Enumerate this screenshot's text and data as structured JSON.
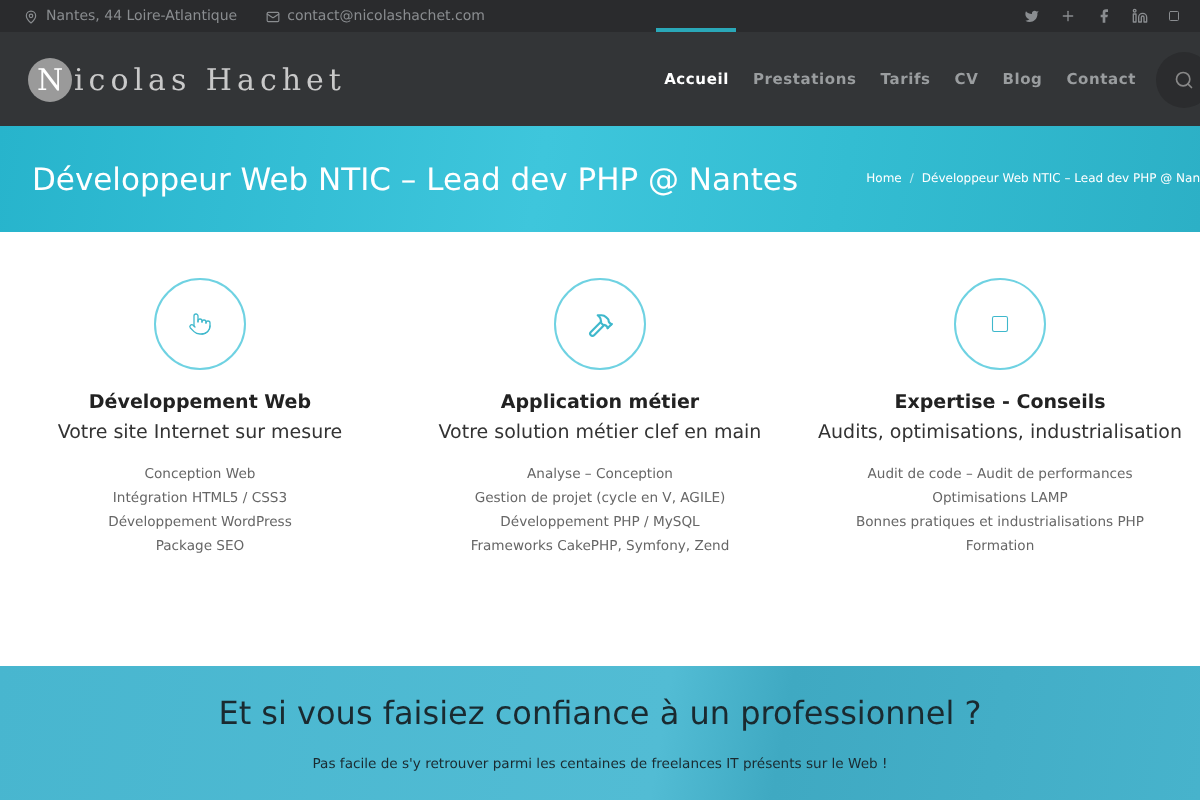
{
  "topbar": {
    "location": "Nantes, 44 Loire-Atlantique",
    "email": "contact@nicolashachet.com",
    "social": [
      {
        "kind": "twitter"
      },
      {
        "kind": "googleplus"
      },
      {
        "kind": "facebook"
      },
      {
        "kind": "linkedin"
      },
      {
        "kind": "other"
      }
    ]
  },
  "header": {
    "logo": {
      "initial": "N",
      "rest": "icolas Hachet"
    },
    "nav": [
      {
        "label": "Accueil",
        "selected": true
      },
      {
        "label": "Prestations",
        "selected": false
      },
      {
        "label": "Tarifs",
        "selected": false
      },
      {
        "label": "CV",
        "selected": false
      },
      {
        "label": "Blog",
        "selected": false
      },
      {
        "label": "Contact",
        "selected": false
      }
    ]
  },
  "banner": {
    "title": "Développeur Web NTIC – Lead dev PHP @ Nantes",
    "breadcrumb": [
      "Home",
      "Développeur Web NTIC – Lead dev PHP @ Nan"
    ],
    "breadcrumb_separator": "/"
  },
  "services": [
    {
      "kind": "pointer",
      "title": "Développement Web",
      "subtitle": "Votre site Internet sur mesure",
      "items": [
        "Conception Web",
        "Intégration HTML5 / CSS3",
        "Développement WordPress",
        "Package SEO"
      ]
    },
    {
      "kind": "tools",
      "title": "Application métier",
      "subtitle": "Votre solution métier clef en main",
      "items": [
        "Analyse – Conception",
        "Gestion de projet (cycle en V, AGILE)",
        "Développement PHP / MySQL",
        "Frameworks CakePHP, Symfony, Zend"
      ]
    },
    {
      "kind": "box",
      "title": "Expertise - Conseils",
      "subtitle": "Audits, optimisations, industrialisation",
      "items": [
        "Audit de code – Audit de performances",
        "Optimisations LAMP",
        "Bonnes pratiques et industrialisations PHP",
        "Formation"
      ]
    }
  ],
  "cta": {
    "title": "Et si vous faisiez confiance à un professionnel ?",
    "text": "Pas facile de s'y retrouver parmi les centaines de freelances IT présents sur le Web !"
  }
}
